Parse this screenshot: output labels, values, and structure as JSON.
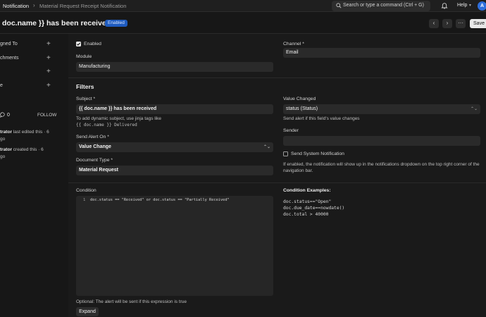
{
  "navbar": {
    "breadcrumb": [
      "Notification",
      "Material Request Receipt Notification"
    ],
    "breadcrumb_sep": "›",
    "search_placeholder": "Search or type a command (Ctrl + G)",
    "help_label": "Help",
    "avatar_initial": "A"
  },
  "header": {
    "title": "doc.name }} has been received",
    "status": "Enabled",
    "save_label": "Save",
    "more_label": "···"
  },
  "sidebar": {
    "items": [
      {
        "label": "gned To"
      },
      {
        "label": "chments"
      },
      {
        "label": ""
      },
      {
        "label": "e"
      }
    ],
    "comment_count": "0",
    "follow_label": "FOLLOW",
    "activity": [
      {
        "user": "trator",
        "text": " last edited this · 6",
        "text2": "go"
      },
      {
        "user": "trator",
        "text": " created this · 6",
        "text2": "go"
      }
    ]
  },
  "form": {
    "enabled_label": "Enabled",
    "enabled_checked": true,
    "module_label": "Module",
    "module_value": "Manufacturing",
    "channel_label": "Channel *",
    "channel_value": "Email",
    "filters_title": "Filters",
    "subject_label": "Subject *",
    "subject_value": "{{ doc.name }} has been received",
    "subject_help": "To add dynamic subject, use jinja tags like",
    "subject_help_code": "{{ doc.name }} Delivered",
    "value_changed_label": "Value Changed",
    "value_changed_value": "status (Status)",
    "value_changed_help": "Send alert if this field's value changes",
    "send_alert_on_label": "Send Alert On *",
    "send_alert_on_value": "Value Change",
    "sender_label": "Sender",
    "sender_value": "",
    "system_notification_label": "Send System Notification",
    "system_notification_checked": false,
    "system_notification_help": "If enabled, the notification will show up in the notifications dropdown on the top right corner of the navigation bar.",
    "document_type_label": "Document Type *",
    "document_type_value": "Material Request",
    "condition_label": "Condition",
    "condition_line_number": "1",
    "condition_code": "doc.status == \"Received\" or doc.status == \"Partially Received\"",
    "condition_help": "Optional: The alert will be sent if this expression is true",
    "expand_label": "Expand",
    "examples_title": "Condition Examples:",
    "examples": [
      "doc.status==\"Open\"",
      "doc.due_date==nowdate()",
      "doc.total > 40000"
    ]
  }
}
